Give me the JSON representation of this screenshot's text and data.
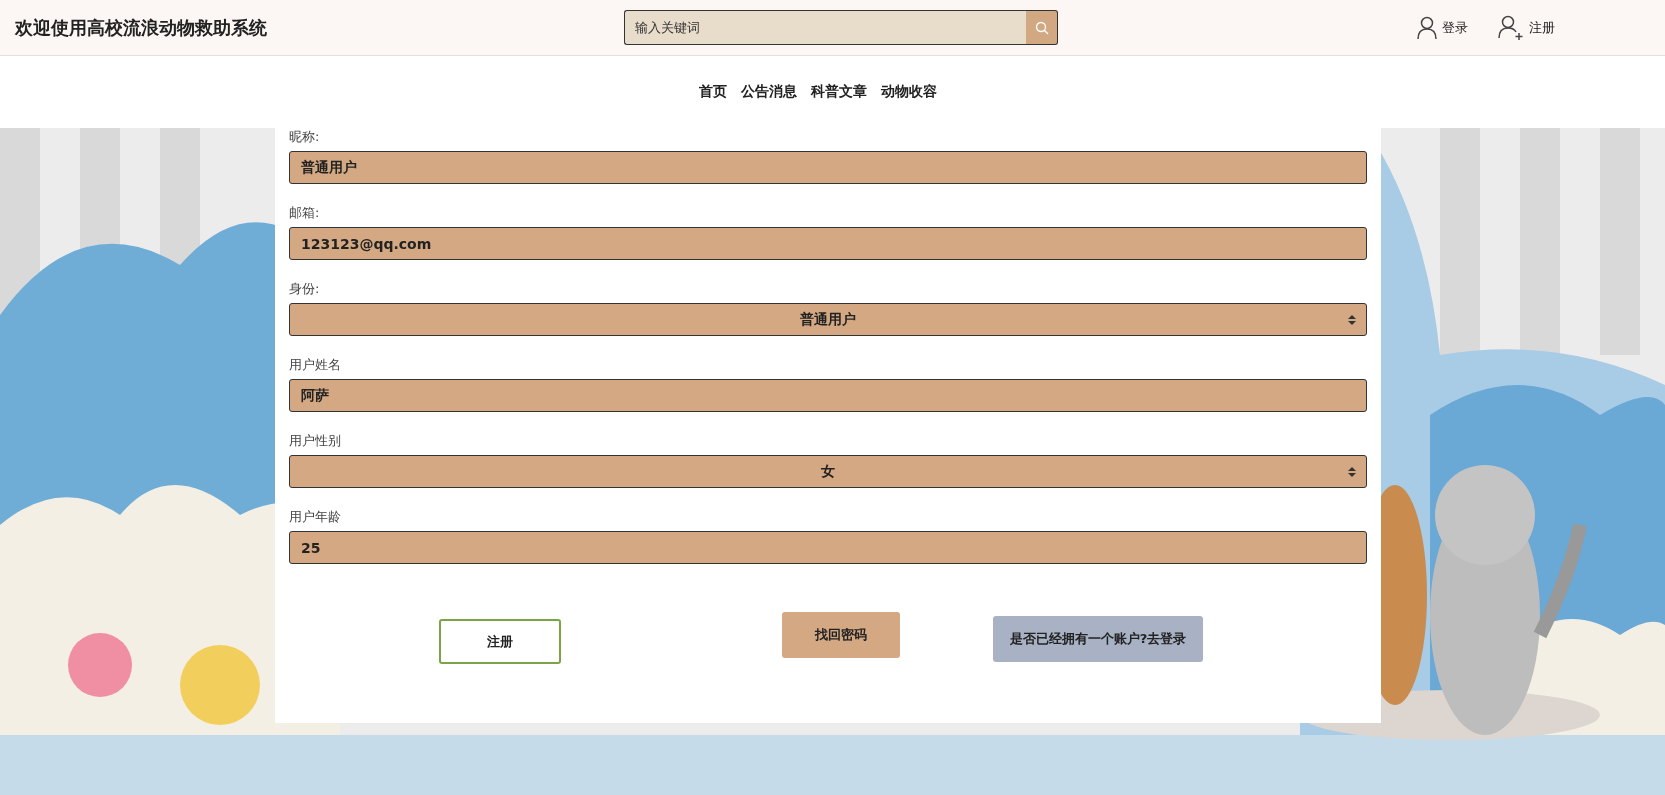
{
  "header": {
    "title": "欢迎使用高校流浪动物救助系统",
    "search": {
      "placeholder": "输入关键词"
    },
    "links": [
      {
        "label": "登录",
        "kind": "user"
      },
      {
        "label": "注册",
        "kind": "user-add"
      }
    ]
  },
  "nav": {
    "items": [
      {
        "label": "首页"
      },
      {
        "label": "公告消息"
      },
      {
        "label": "科普文章"
      },
      {
        "label": "动物收容"
      }
    ]
  },
  "form": {
    "fields": [
      {
        "label": "昵称:",
        "kind": "input",
        "value": "普通用户"
      },
      {
        "label": "邮箱:",
        "kind": "input",
        "value": "123123@qq.com"
      },
      {
        "label": "身份:",
        "kind": "select",
        "value": "普通用户"
      },
      {
        "label": "用户姓名",
        "kind": "input",
        "value": "阿萨"
      },
      {
        "label": "用户性别",
        "kind": "select",
        "value": "女"
      },
      {
        "label": "用户年龄",
        "kind": "input",
        "value": "25"
      }
    ],
    "buttons": [
      {
        "label": "注册",
        "kind": "outline"
      },
      {
        "label": "找回密码",
        "kind": "primary"
      },
      {
        "label": "是否已经拥有一个账户?去登录",
        "kind": "secondary"
      }
    ]
  }
}
